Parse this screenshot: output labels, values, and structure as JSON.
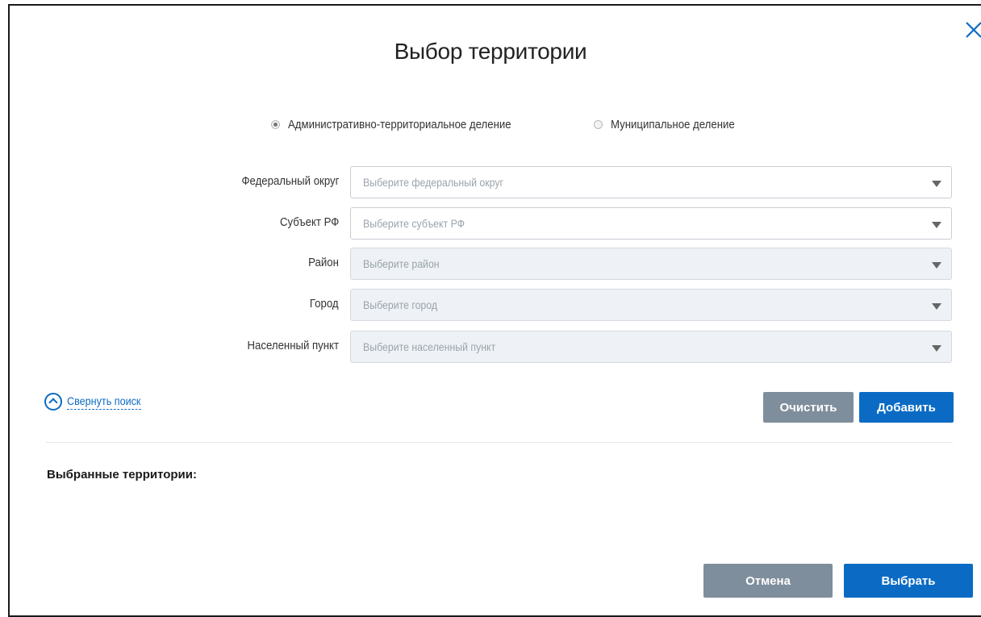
{
  "dialog": {
    "title": "Выбор территории"
  },
  "division_type": {
    "options": [
      {
        "label": "Административно-территориальное деление",
        "selected": true
      },
      {
        "label": "Муниципальное деление",
        "selected": false
      }
    ]
  },
  "fields": [
    {
      "label": "Федеральный округ",
      "placeholder": "Выберите федеральный округ",
      "disabled": false
    },
    {
      "label": "Субъект РФ",
      "placeholder": "Выберите субъект РФ",
      "disabled": false
    },
    {
      "label": "Район",
      "placeholder": "Выберите район",
      "disabled": true
    },
    {
      "label": "Город",
      "placeholder": "Выберите город",
      "disabled": true
    },
    {
      "label": "Населенный пункт",
      "placeholder": "Выберите населенный пункт",
      "disabled": true
    }
  ],
  "search": {
    "collapse_label": "Свернуть поиск",
    "clear_label": "Очистить",
    "add_label": "Добавить"
  },
  "selected": {
    "title": "Выбранные территории:"
  },
  "footer": {
    "cancel_label": "Отмена",
    "select_label": "Выбрать"
  },
  "colors": {
    "accent": "#0b6bc4",
    "secondary_button": "#7f8e9c",
    "disabled_field": "#eef2f6"
  }
}
